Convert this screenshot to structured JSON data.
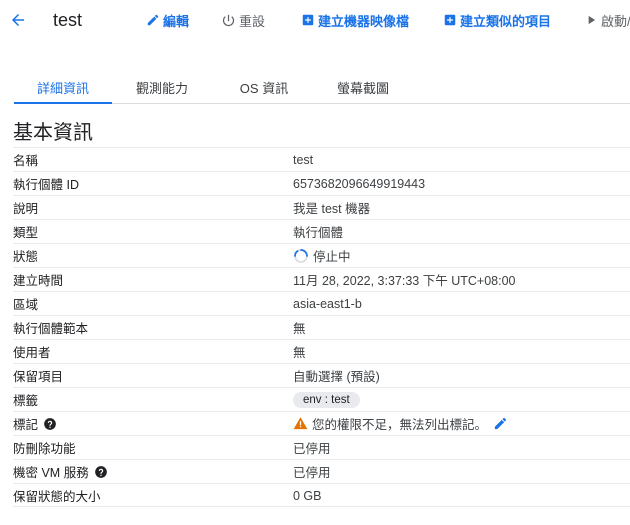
{
  "toolbar": {
    "title": "test",
    "edit": "編輯",
    "reset": "重設",
    "create_image": "建立機器映像檔",
    "create_similar": "建立類似的項目",
    "start": "啟動/"
  },
  "tabs": [
    "詳細資訊",
    "觀測能力",
    "OS 資訊",
    "螢幕截圖"
  ],
  "section_title": "基本資訊",
  "rows": [
    {
      "label": "名稱",
      "value": "test"
    },
    {
      "label": "執行個體 ID",
      "value": "6573682096649919443"
    },
    {
      "label": "說明",
      "value": "我是 test 機器"
    },
    {
      "label": "類型",
      "value": "執行個體"
    },
    {
      "label": "狀態",
      "value": "停止中"
    },
    {
      "label": "建立時間",
      "value": "11月 28, 2022, 3:37:33 下午 UTC+08:00"
    },
    {
      "label": "區域",
      "value": "asia-east1-b"
    },
    {
      "label": "執行個體範本",
      "value": "無"
    },
    {
      "label": "使用者",
      "value": "無"
    },
    {
      "label": "保留項目",
      "value": "自動選擇 (預設)"
    },
    {
      "label": "標籤",
      "value": "env : test"
    },
    {
      "label": "標記",
      "value": "您的權限不足，無法列出標記。"
    },
    {
      "label": "防刪除功能",
      "value": "已停用"
    },
    {
      "label": "機密 VM 服務",
      "value": "已停用"
    },
    {
      "label": "保留狀態的大小",
      "value": "0 GB"
    }
  ],
  "colors": {
    "accent": "#1a73e8",
    "warning": "#e37400"
  },
  "icons": [
    "back-arrow-icon",
    "pencil-icon",
    "power-icon",
    "add-box-icon",
    "spinner-icon",
    "help-icon",
    "warning-icon",
    "play-icon"
  ]
}
